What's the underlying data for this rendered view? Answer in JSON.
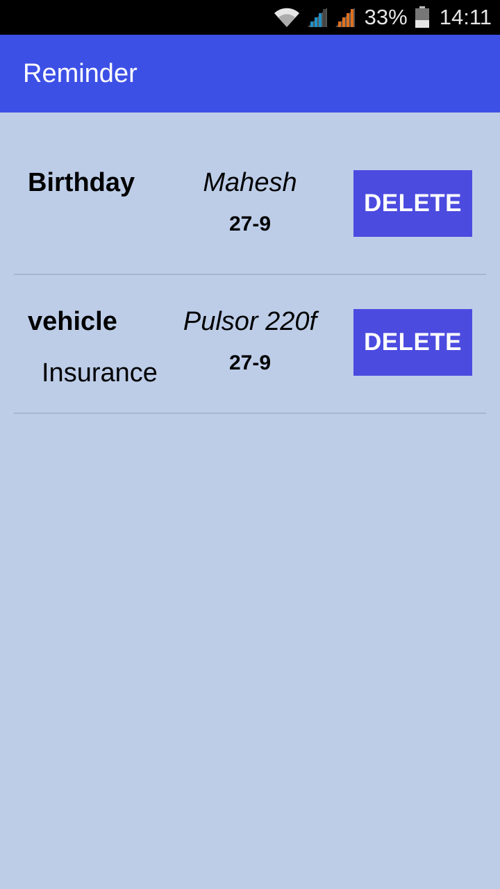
{
  "status_bar": {
    "battery_percent": "33%",
    "time": "14:11",
    "icons": [
      "wifi-icon",
      "cellular-signal-icon",
      "cellular-signal-icon",
      "battery-icon"
    ],
    "colors": {
      "signal1": "#1e90c8",
      "signal2": "#e0701e"
    }
  },
  "app_bar": {
    "title": "Reminder",
    "color": "#3d50e6"
  },
  "reminders": [
    {
      "type": "Birthday",
      "subtype": "",
      "name": "Mahesh",
      "date": "27-9",
      "delete_label": "DELETE"
    },
    {
      "type": "vehicle",
      "subtype": "Insurance",
      "name": "Pulsor 220f",
      "date": "27-9",
      "delete_label": "DELETE"
    }
  ],
  "colors": {
    "background": "#bdcde8",
    "delete_button": "#4b4be0"
  }
}
